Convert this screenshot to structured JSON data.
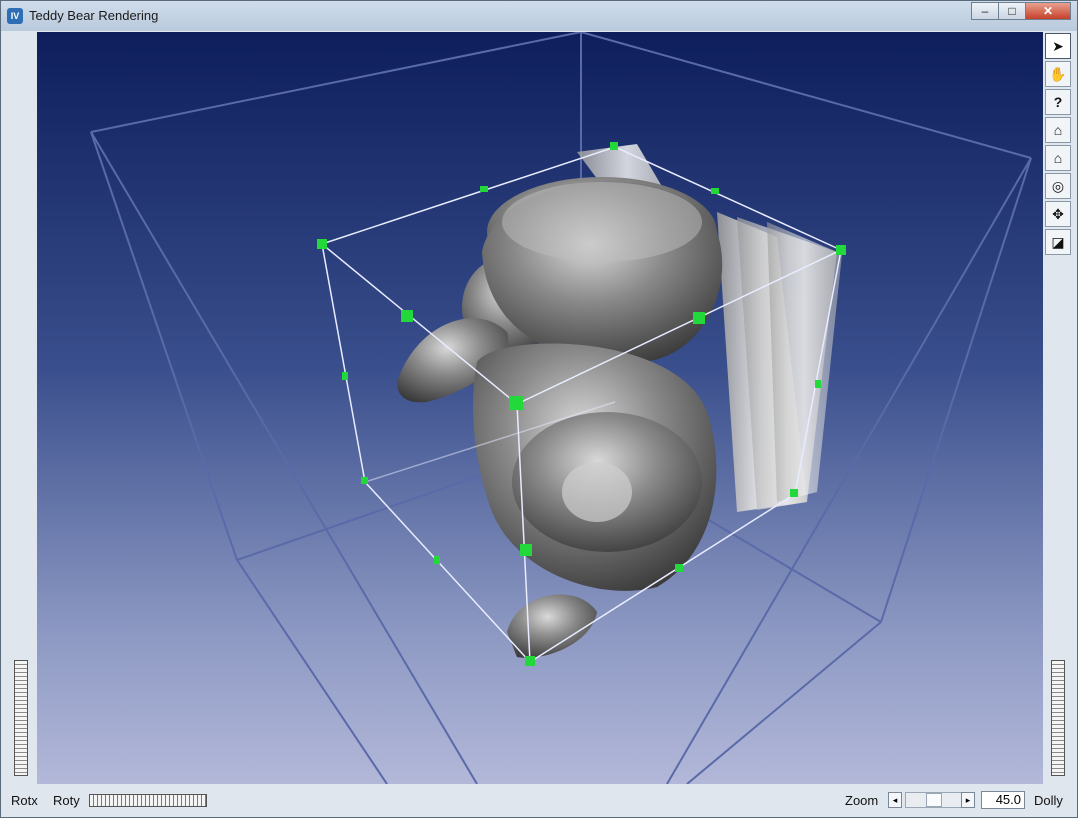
{
  "window": {
    "title": "Teddy Bear Rendering",
    "app_icon_text": "IV",
    "buttons": {
      "minimize": "‒",
      "maximize": "□",
      "close": "✕"
    }
  },
  "toolbar": {
    "tools": [
      {
        "name": "select-arrow-icon",
        "glyph": "➤"
      },
      {
        "name": "hand-view-icon",
        "glyph": "✋"
      },
      {
        "name": "help-icon",
        "glyph": "?"
      },
      {
        "name": "home-icon",
        "glyph": "⌂"
      },
      {
        "name": "set-home-icon",
        "glyph": "⌂"
      },
      {
        "name": "view-all-icon",
        "glyph": "◎"
      },
      {
        "name": "seek-icon",
        "glyph": "✥"
      },
      {
        "name": "perspective-icon",
        "glyph": "◪"
      }
    ]
  },
  "bottom": {
    "rotx_label": "Rotx",
    "roty_label": "Roty",
    "zoom_label": "Zoom",
    "zoom_value": "45.0",
    "dolly_label": "Dolly",
    "left_arrow": "◂",
    "right_arrow": "▸"
  },
  "scene": {
    "background_top": "#0e1e5c",
    "background_bottom": "#b3b8d9",
    "manipulator_color": "#22d83a"
  }
}
